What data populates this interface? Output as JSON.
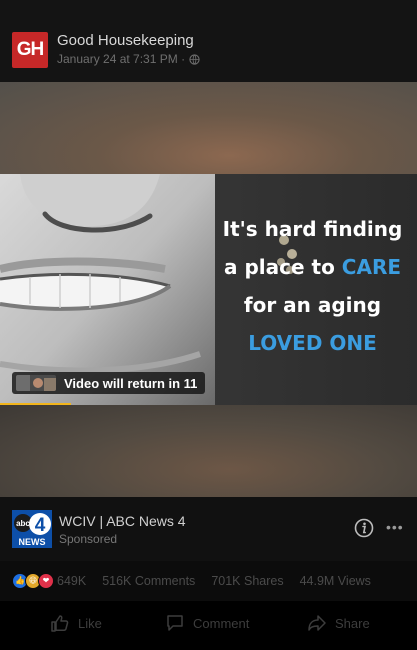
{
  "post": {
    "page_logo_text": "GH",
    "page_name": "Good Housekeeping",
    "timestamp": "January 24 at 7:31 PM ·",
    "privacy_icon": "globe-icon"
  },
  "ad": {
    "line1": "It's hard finding",
    "line2_prefix": "a place to ",
    "line2_highlight": "CARE",
    "line3": "for an aging",
    "line4_highlight": "LOVED ONE",
    "highlight_color": "#3b9de0",
    "badge_text": "Video will return in 11",
    "progress": 0.17,
    "progress_color": "#f2b51c"
  },
  "sponsor": {
    "logo_top": "abc",
    "logo_number": "4",
    "logo_bottom": "NEWS",
    "name": "WCIV | ABC News 4",
    "label": "Sponsored",
    "info_icon": "info-circle-icon",
    "more_icon": "ellipsis-icon"
  },
  "stats": {
    "reactions": [
      "like-icon",
      "haha-icon",
      "love-icon"
    ],
    "reaction_count": "649K",
    "comments": "516K Comments",
    "shares": "701K Shares",
    "views": "44.9M Views"
  },
  "actions": {
    "like": "Like",
    "comment": "Comment",
    "share": "Share"
  }
}
